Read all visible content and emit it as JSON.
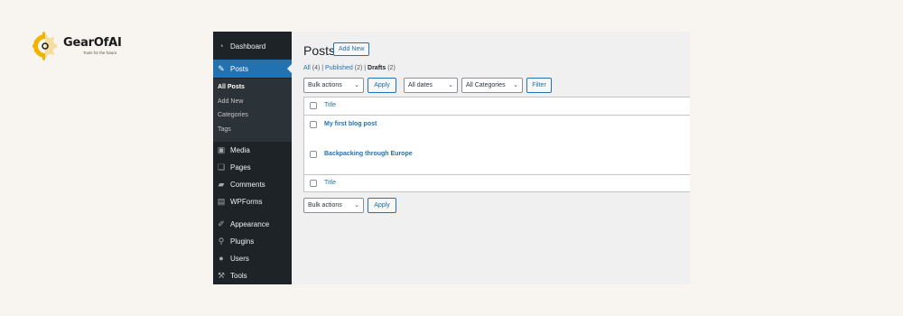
{
  "brand": {
    "name": "GearOfAI",
    "tagline": "Tools for the future",
    "accent": "#f0b400"
  },
  "sidebar": {
    "items": [
      {
        "label": "Dashboard",
        "icon": "dashboard-icon",
        "glyph": "◔"
      },
      {
        "label": "Posts",
        "icon": "pushpin-icon",
        "glyph": "✎"
      },
      {
        "label": "Media",
        "icon": "media-icon",
        "glyph": "▣"
      },
      {
        "label": "Pages",
        "icon": "pages-icon",
        "glyph": "❏"
      },
      {
        "label": "Comments",
        "icon": "comments-icon",
        "glyph": "▰"
      },
      {
        "label": "WPForms",
        "icon": "wpforms-icon",
        "glyph": "▤"
      },
      {
        "label": "Appearance",
        "icon": "paintbrush-icon",
        "glyph": "✐"
      },
      {
        "label": "Plugins",
        "icon": "plugins-icon",
        "glyph": "⚲"
      },
      {
        "label": "Users",
        "icon": "users-icon",
        "glyph": "●"
      },
      {
        "label": "Tools",
        "icon": "wrench-icon",
        "glyph": "⚒"
      }
    ],
    "submenu": [
      "All Posts",
      "Add New",
      "Categories",
      "Tags"
    ],
    "active_color": "#2271b1"
  },
  "main": {
    "title": "Posts",
    "add_new": "Add New",
    "filters": {
      "all": "All",
      "all_count": "(4)",
      "published": "Published",
      "published_count": "(2)",
      "drafts": "Drafts",
      "drafts_count": "(2)",
      "sep": "|"
    },
    "bulk_actions": "Bulk actions",
    "apply": "Apply",
    "all_dates": "All dates",
    "all_categories": "All Categories",
    "filter": "Filter",
    "table": {
      "header": "Title",
      "rows": [
        "My first blog post",
        "Backpacking through Europe"
      ],
      "footer": "Title"
    }
  }
}
